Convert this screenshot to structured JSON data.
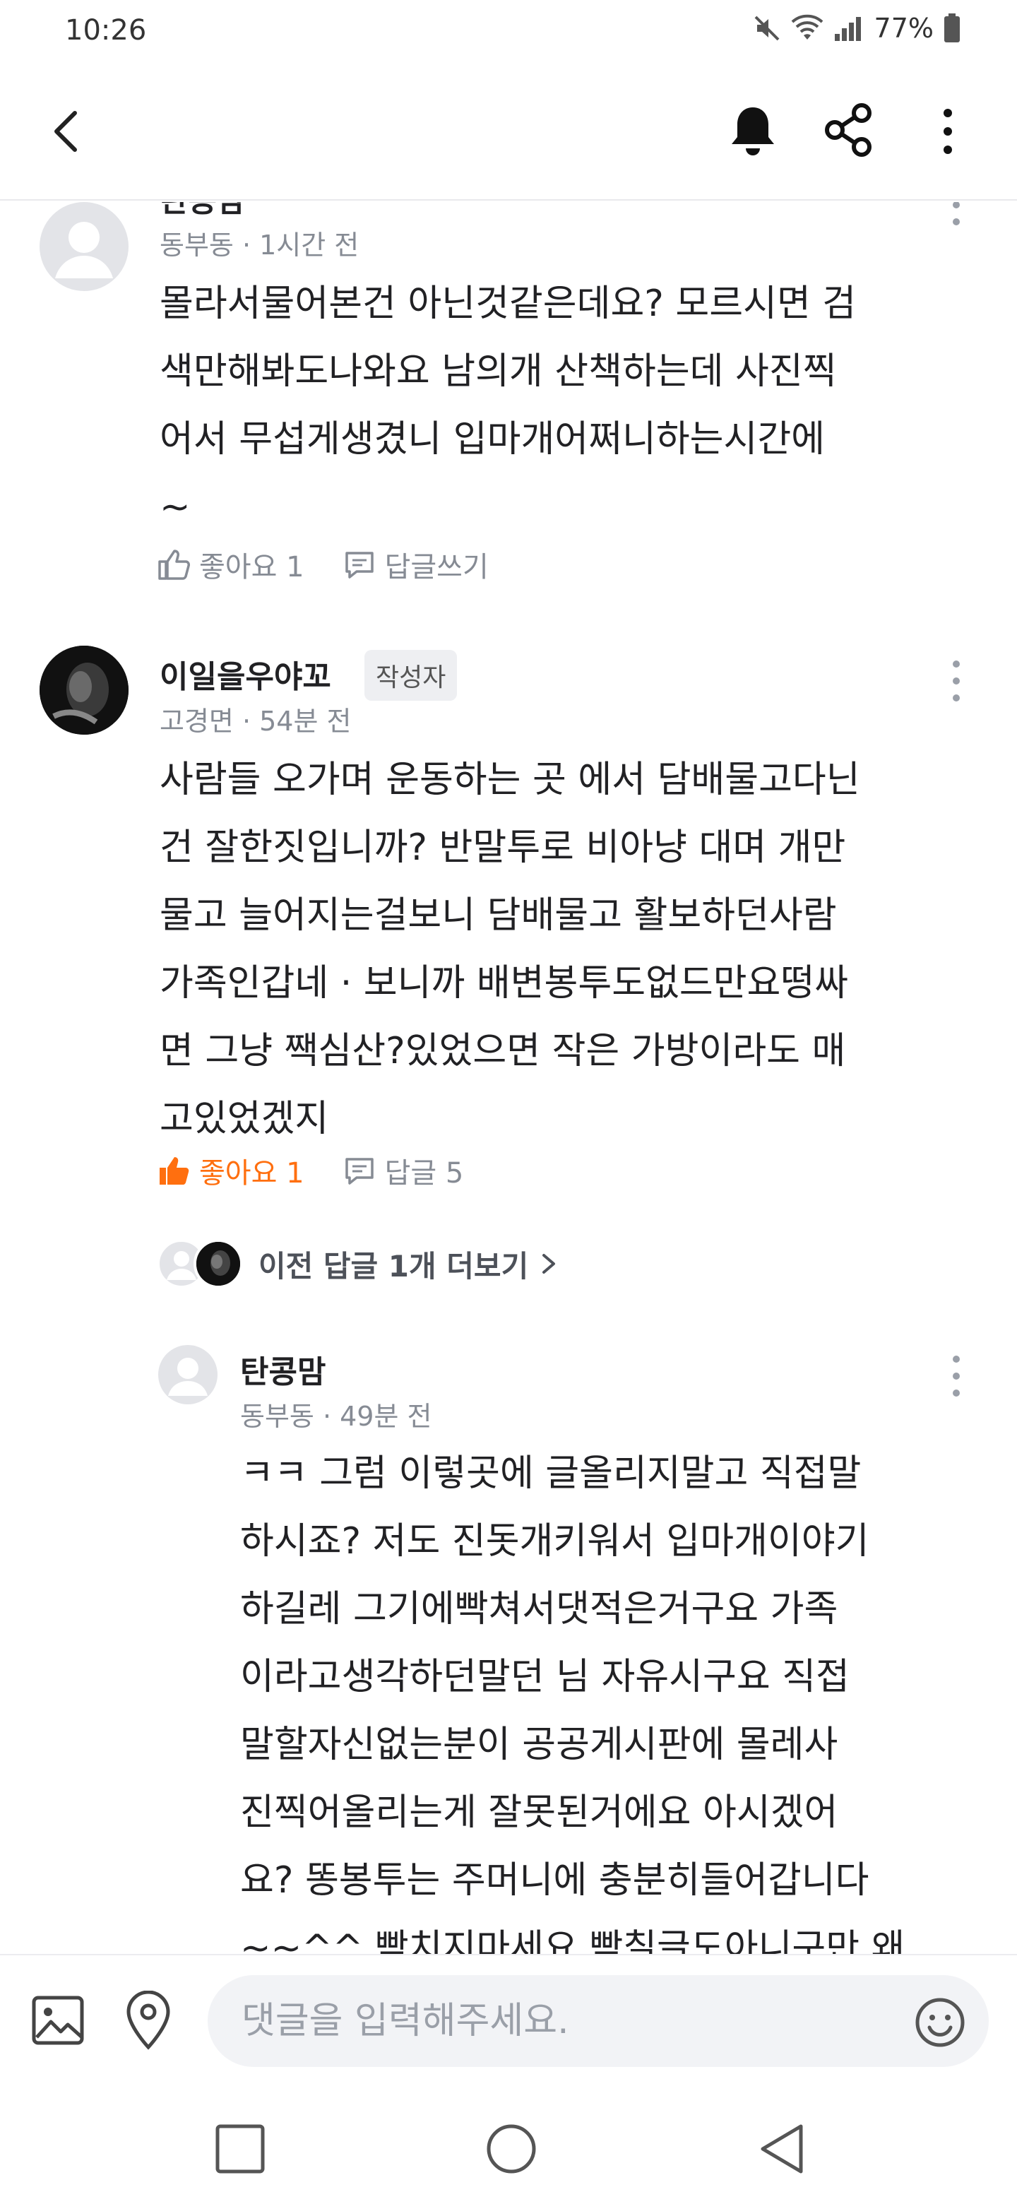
{
  "status": {
    "time": "10:26",
    "battery": "77%"
  },
  "header": {
    "icons": [
      "back-arrow-icon",
      "bell-icon",
      "share-icon",
      "more-vertical-icon"
    ]
  },
  "comments": [
    {
      "author": "탄콩맘",
      "meta": "동부동 · 1시간 전",
      "body": "몰라서물어본건 아닌것같은데요? 모르시면 검\n색만해봐도나와요 남의개 산책하는데 사진찍\n어서 무섭게생겼니 입마개어쩌니하는시간에\n~",
      "like_label": "좋아요 1",
      "reply_label": "답글쓰기"
    },
    {
      "author": "이일을우야꼬",
      "badge": "작성자",
      "meta": "고경면 · 54분 전",
      "body": "사람들 오가며 운동하는 곳 에서 담배물고다닌\n건 잘한짓입니까? 반말투로 비아냥 대며 개만\n물고 늘어지는걸보니 담배물고 활보하던사람\n가족인갑네 · 보니까 배변봉투도없드만요떵싸\n면 그냥 짹심산?있었으면 작은 가방이라도 매\n고있었겠지",
      "like_label": "좋아요 1",
      "reply_label": "답글 5",
      "more_replies": "이전 답글 1개 더보기"
    },
    {
      "author": "탄콩맘",
      "meta": "동부동 · 49분 전",
      "body": "ㅋㅋ 그럼 이렇곳에 글올리지말고 직접말\n하시죠? 저도 진돗개키워서 입마개이야기\n하길레 그기에빡쳐서댓적은거구요 가족\n이라고생각하던말던 님 자유시구요 직접\n말할자신없는분이 공공게시판에 몰레사\n진찍어올리는게 잘못된거에요 아시겠어\n요? 똥봉투는 주머니에 충분히들어갑니다\n~~^^ 빡치지마세요 빡칠글도아니구만 왜\n그러세요??"
    }
  ],
  "input": {
    "placeholder": "댓글을 입력해주세요."
  },
  "colors": {
    "accent": "#ff6f0f",
    "meta": "#868b94"
  }
}
